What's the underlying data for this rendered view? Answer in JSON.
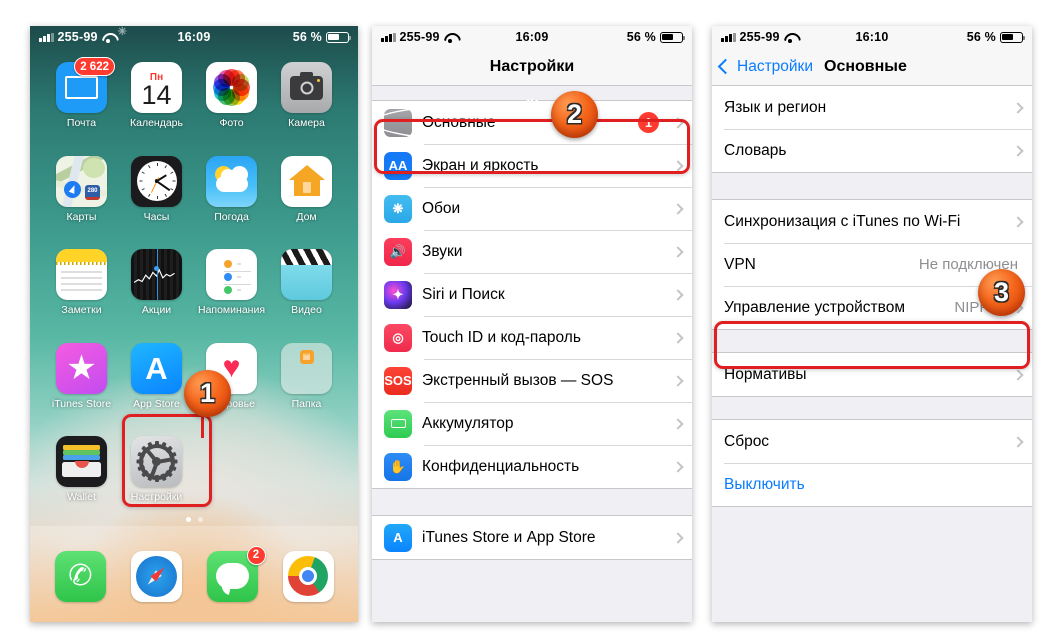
{
  "colors": {
    "accent_blue": "#0a7cff",
    "badge_red": "#ff3b30",
    "annotation_red": "#e02020",
    "annotation_orange": "#f4651a",
    "list_bg": "#efeff4",
    "separator": "#c8c7cc",
    "secondary_text": "#8e8e93"
  },
  "home": {
    "status": {
      "carrier": "255-99",
      "time": "16:09",
      "battery_percent": "56 %",
      "signal_icon": "signal-bars-icon",
      "wifi_icon": "wifi-icon",
      "sync_icon": "sync-spinner-icon",
      "battery_icon": "battery-icon"
    },
    "apps": [
      {
        "label": "Почта",
        "icon": "mail-icon",
        "badge": "2 622"
      },
      {
        "label": "Календарь",
        "icon": "calendar-icon",
        "day_of_week": "Пн",
        "day_number": "14"
      },
      {
        "label": "Фото",
        "icon": "photos-icon"
      },
      {
        "label": "Камера",
        "icon": "camera-icon"
      },
      {
        "label": "Карты",
        "icon": "maps-icon",
        "shield_text": "280"
      },
      {
        "label": "Часы",
        "icon": "clock-icon"
      },
      {
        "label": "Погода",
        "icon": "weather-icon"
      },
      {
        "label": "Дом",
        "icon": "home-app-icon"
      },
      {
        "label": "Заметки",
        "icon": "notes-icon"
      },
      {
        "label": "Акции",
        "icon": "stocks-icon"
      },
      {
        "label": "Напоминания",
        "icon": "reminders-icon"
      },
      {
        "label": "Видео",
        "icon": "videos-icon"
      },
      {
        "label": "iTunes Store",
        "icon": "itunes-store-icon"
      },
      {
        "label": "App Store",
        "icon": "app-store-icon"
      },
      {
        "label": "Здоровье",
        "icon": "health-icon"
      },
      {
        "label": "Папка",
        "icon": "folder-icon"
      },
      {
        "label": "Wallet",
        "icon": "wallet-icon"
      },
      {
        "label": "Настройки",
        "icon": "settings-gear-icon"
      }
    ],
    "dock": [
      {
        "label": "Телефон",
        "icon": "phone-icon"
      },
      {
        "label": "Safari",
        "icon": "safari-compass-icon"
      },
      {
        "label": "Сообщения",
        "icon": "messages-icon",
        "badge": "2"
      },
      {
        "label": "Chrome",
        "icon": "chrome-icon"
      }
    ]
  },
  "settings": {
    "status": {
      "carrier": "255-99",
      "time": "16:09",
      "battery_percent": "56 %"
    },
    "title": "Настройки",
    "groups": [
      {
        "rows": [
          {
            "label": "Основные",
            "icon": "gear-icon",
            "badge": "1",
            "chevron": true
          },
          {
            "label": "Экран и яркость",
            "icon": "display-aa-icon",
            "chevron": true
          },
          {
            "label": "Обои",
            "icon": "wallpaper-icon",
            "chevron": true
          },
          {
            "label": "Звуки",
            "icon": "sound-speaker-icon",
            "chevron": true
          },
          {
            "label": "Siri и Поиск",
            "icon": "siri-icon",
            "chevron": true
          },
          {
            "label": "Touch ID и код-пароль",
            "icon": "touch-id-icon",
            "chevron": true
          },
          {
            "label": "Экстренный вызов — SOS",
            "icon": "sos-icon",
            "chevron": true
          },
          {
            "label": "Аккумулятор",
            "icon": "battery-app-icon",
            "chevron": true
          },
          {
            "label": "Конфиденциальность",
            "icon": "privacy-hand-icon",
            "chevron": true
          }
        ]
      },
      {
        "rows": [
          {
            "label": "iTunes Store и App Store",
            "icon": "app-store-icon",
            "chevron": true
          }
        ]
      }
    ]
  },
  "general": {
    "status": {
      "carrier": "255-99",
      "time": "16:10",
      "battery_percent": "56 %"
    },
    "back_label": "Настройки",
    "title": "Основные",
    "groups": [
      {
        "rows": [
          {
            "label": "Язык и регион",
            "chevron": true
          },
          {
            "label": "Словарь",
            "chevron": true
          }
        ]
      },
      {
        "rows": [
          {
            "label": "Синхронизация с iTunes по Wi-Fi",
            "chevron": true
          },
          {
            "label": "VPN",
            "value": "Не подключен",
            "chevron": false
          },
          {
            "label": "Управление устройством",
            "value": "NIPP...",
            "chevron": true
          }
        ]
      },
      {
        "rows": [
          {
            "label": "Нормативы",
            "chevron": true
          }
        ]
      },
      {
        "rows": [
          {
            "label": "Сброс",
            "chevron": true
          },
          {
            "label": "Выключить",
            "style": "blue",
            "chevron": false
          }
        ]
      }
    ]
  },
  "annotations": [
    {
      "number": "1",
      "target": "settings-app-icon-home-screen"
    },
    {
      "number": "2",
      "target": "general-settings-row"
    },
    {
      "number": "3",
      "target": "device-management-row"
    }
  ]
}
